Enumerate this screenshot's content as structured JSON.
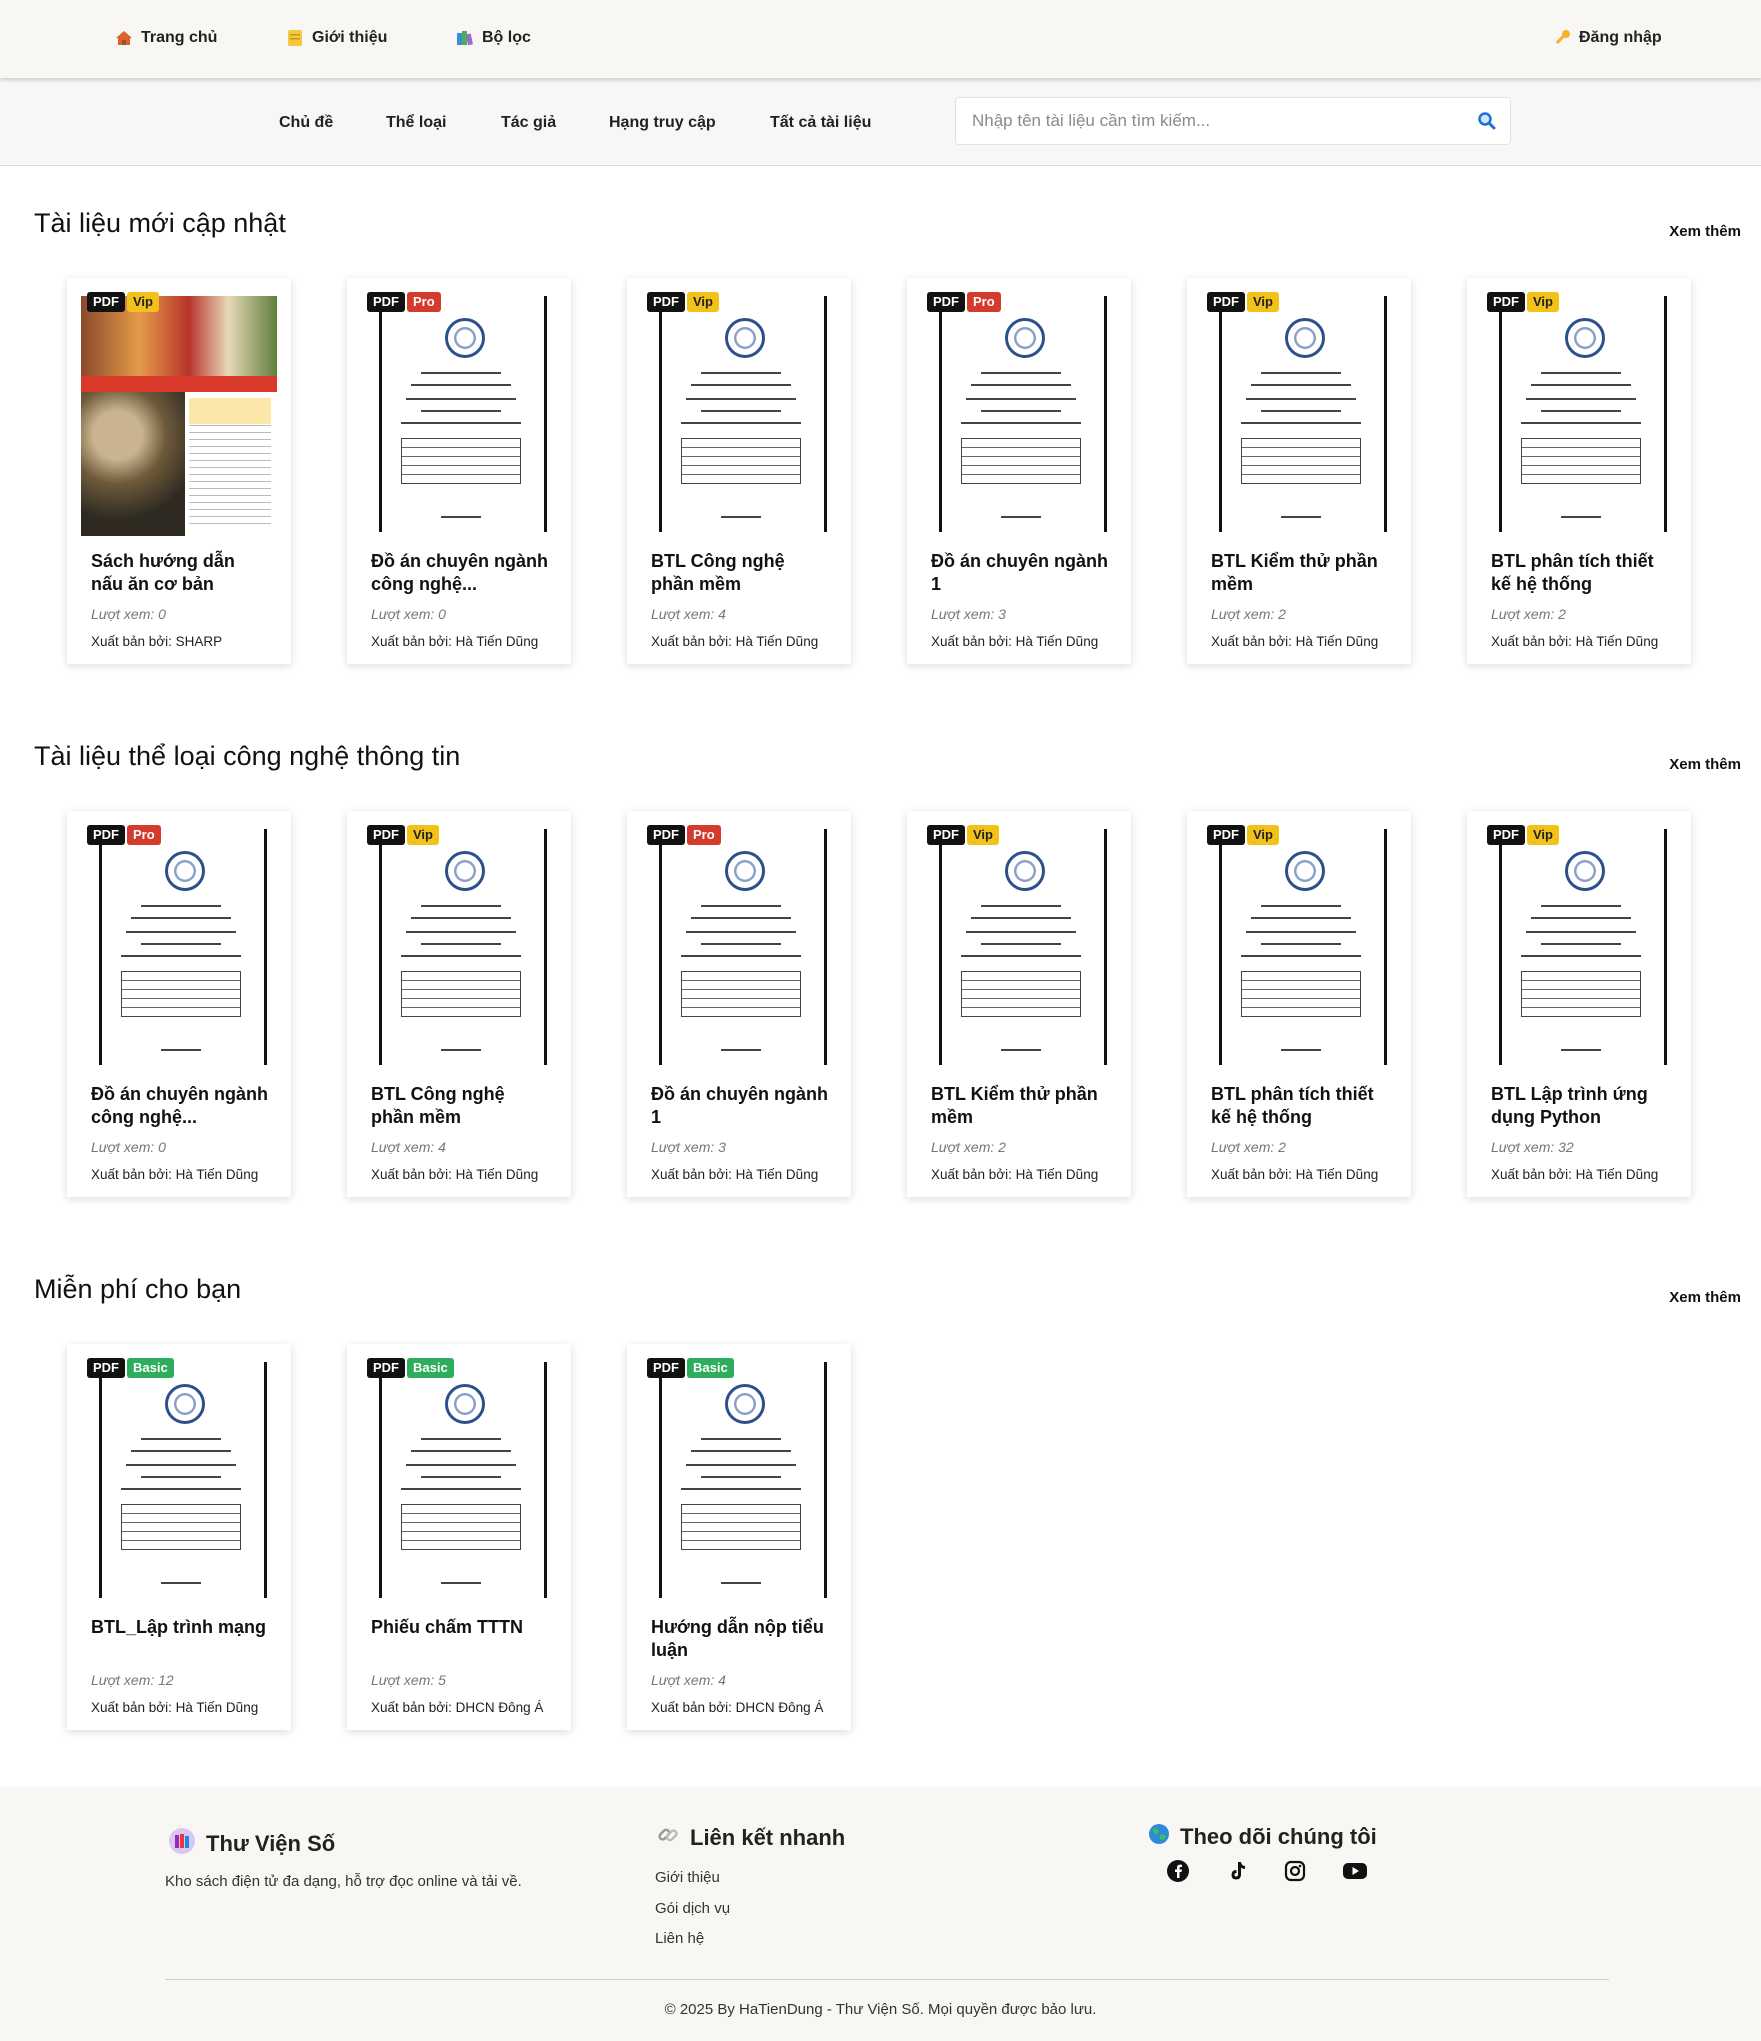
{
  "topnav": {
    "home": "Trang chủ",
    "about": "Giới thiệu",
    "filter": "Bộ lọc",
    "login": "Đăng nhập"
  },
  "subnav": {
    "items": [
      "Chủ đề",
      "Thể loại",
      "Tác giả",
      "Hạng truy cập",
      "Tất cả tài liệu"
    ],
    "search_placeholder": "Nhập tên tài liệu cần tìm kiếm..."
  },
  "sections": [
    {
      "title": "Tài liệu mới cập nhật",
      "see_more": "Xem thêm",
      "cards": [
        {
          "format": "PDF",
          "tier": "Vip",
          "title": "Sách hướng dẫn nấu ăn cơ bản",
          "views": "Lượt xem: 0",
          "publisher": "Xuất bản bởi: SHARP"
        },
        {
          "format": "PDF",
          "tier": "Pro",
          "title": "Đồ án chuyên ngành công nghệ...",
          "views": "Lượt xem: 0",
          "publisher": "Xuất bản bởi: Hà Tiến Dũng"
        },
        {
          "format": "PDF",
          "tier": "Vip",
          "title": "BTL Công nghệ phần mềm",
          "views": "Lượt xem: 4",
          "publisher": "Xuất bản bởi: Hà Tiến Dũng"
        },
        {
          "format": "PDF",
          "tier": "Pro",
          "title": "Đồ án chuyên ngành 1",
          "views": "Lượt xem: 3",
          "publisher": "Xuất bản bởi: Hà Tiến Dũng"
        },
        {
          "format": "PDF",
          "tier": "Vip",
          "title": "BTL Kiểm thử phần mềm",
          "views": "Lượt xem: 2",
          "publisher": "Xuất bản bởi: Hà Tiến Dũng"
        },
        {
          "format": "PDF",
          "tier": "Vip",
          "title": "BTL phân tích thiết kế hệ thống",
          "views": "Lượt xem: 2",
          "publisher": "Xuất bản bởi: Hà Tiến Dũng"
        }
      ]
    },
    {
      "title": "Tài liệu thể loại công nghệ thông tin",
      "see_more": "Xem thêm",
      "cards": [
        {
          "format": "PDF",
          "tier": "Pro",
          "title": "Đồ án chuyên ngành công nghệ...",
          "views": "Lượt xem: 0",
          "publisher": "Xuất bản bởi: Hà Tiến Dũng"
        },
        {
          "format": "PDF",
          "tier": "Vip",
          "title": "BTL Công nghệ phần mềm",
          "views": "Lượt xem: 4",
          "publisher": "Xuất bản bởi: Hà Tiến Dũng"
        },
        {
          "format": "PDF",
          "tier": "Pro",
          "title": "Đồ án chuyên ngành 1",
          "views": "Lượt xem: 3",
          "publisher": "Xuất bản bởi: Hà Tiến Dũng"
        },
        {
          "format": "PDF",
          "tier": "Vip",
          "title": "BTL Kiểm thử phần mềm",
          "views": "Lượt xem: 2",
          "publisher": "Xuất bản bởi: Hà Tiến Dũng"
        },
        {
          "format": "PDF",
          "tier": "Vip",
          "title": "BTL phân tích thiết kế hệ thống",
          "views": "Lượt xem: 2",
          "publisher": "Xuất bản bởi: Hà Tiến Dũng"
        },
        {
          "format": "PDF",
          "tier": "Vip",
          "title": "BTL Lập trình ứng dụng Python",
          "views": "Lượt xem: 32",
          "publisher": "Xuất bản bởi: Hà Tiến Dũng"
        }
      ]
    },
    {
      "title": "Miễn phí cho bạn",
      "see_more": "Xem thêm",
      "cards": [
        {
          "format": "PDF",
          "tier": "Basic",
          "title": "BTL_Lập trình mạng",
          "views": "Lượt xem: 12",
          "publisher": "Xuất bản bởi: Hà Tiến Dũng"
        },
        {
          "format": "PDF",
          "tier": "Basic",
          "title": "Phiếu chấm TTTN",
          "views": "Lượt xem: 5",
          "publisher": "Xuất bản bởi: DHCN Đông Á"
        },
        {
          "format": "PDF",
          "tier": "Basic",
          "title": "Hướng dẫn nộp tiểu luận",
          "views": "Lượt xem: 4",
          "publisher": "Xuất bản bởi: DHCN Đông Á"
        }
      ]
    }
  ],
  "footer": {
    "brand": "Thư Viện Số",
    "description": "Kho sách điện tử đa dạng, hỗ trợ đọc online và tải về.",
    "links_title": "Liên kết nhanh",
    "links": [
      "Giới thiệu",
      "Gói dịch vụ",
      "Liên hệ"
    ],
    "follow_title": "Theo dõi chúng tôi",
    "social_icons": [
      "facebook-icon",
      "tiktok-icon",
      "instagram-icon",
      "youtube-icon"
    ],
    "copyright": "© 2025 By HaTienDung - Thư Viện Số. Mọi quyền được bảo lưu."
  },
  "colors": {
    "vip": "#f2c21b",
    "pro": "#d33b2c",
    "basic": "#2cae5d",
    "pdf": "#111111"
  }
}
